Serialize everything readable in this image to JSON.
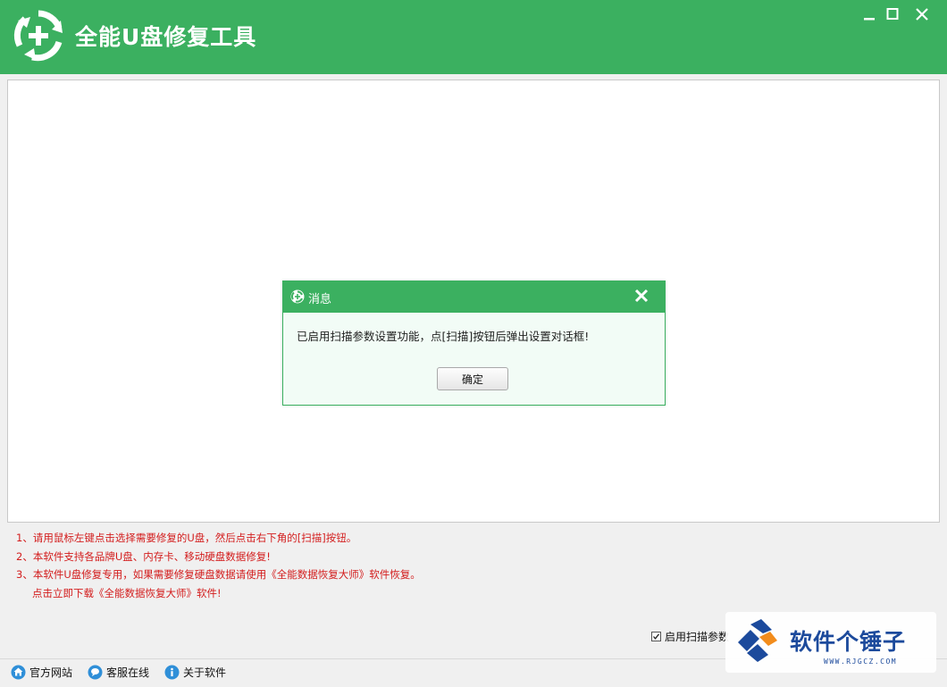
{
  "app": {
    "title": "全能U盘修复工具",
    "brand_color": "#3bb060"
  },
  "window_controls": {
    "minimize_icon": "minimize-icon",
    "maximize_icon": "maximize-icon",
    "close_icon": "close-icon"
  },
  "notes": [
    "1、请用鼠标左键点击选择需要修复的U盘，然后点击右下角的[扫描]按钮。",
    "2、本软件支持各品牌U盘、内存卡、移动硬盘数据修复!",
    "3、本软件U盘修复专用，如果需要修复硬盘数据请使用《全能数据恢复大师》软件恢复。",
    "点击立即下载《全能数据恢复大师》软件!"
  ],
  "notes_color": "#d31d1d",
  "scan_option": {
    "label": "启用扫描参数",
    "checked": true
  },
  "footer": {
    "links": [
      {
        "label": "官方网站",
        "icon": "home-icon"
      },
      {
        "label": "客服在线",
        "icon": "chat-icon"
      },
      {
        "label": "关于软件",
        "icon": "info-icon"
      }
    ]
  },
  "dialog": {
    "title": "消息",
    "message": "已启用扫描参数设置功能，点[扫描]按钮后弹出设置对话框!",
    "ok_label": "确定"
  },
  "watermark": {
    "text": "软件个锤子",
    "sub": "WWW.RJGCZ.COM",
    "color": "#1c4a9c"
  }
}
